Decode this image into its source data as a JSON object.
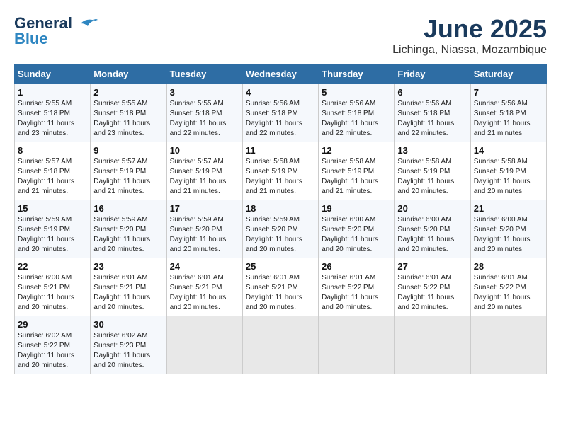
{
  "header": {
    "logo_general": "General",
    "logo_blue": "Blue",
    "title": "June 2025",
    "subtitle": "Lichinga, Niassa, Mozambique"
  },
  "calendar": {
    "days_of_week": [
      "Sunday",
      "Monday",
      "Tuesday",
      "Wednesday",
      "Thursday",
      "Friday",
      "Saturday"
    ],
    "weeks": [
      [
        {
          "day": "",
          "empty": true
        },
        {
          "day": "",
          "empty": true
        },
        {
          "day": "",
          "empty": true
        },
        {
          "day": "",
          "empty": true
        },
        {
          "day": "",
          "empty": true
        },
        {
          "day": "",
          "empty": true
        },
        {
          "day": "",
          "empty": true
        }
      ],
      [
        {
          "num": "1",
          "rise": "5:55 AM",
          "set": "5:18 PM",
          "daylight": "11 hours and 23 minutes."
        },
        {
          "num": "2",
          "rise": "5:55 AM",
          "set": "5:18 PM",
          "daylight": "11 hours and 23 minutes."
        },
        {
          "num": "3",
          "rise": "5:55 AM",
          "set": "5:18 PM",
          "daylight": "11 hours and 22 minutes."
        },
        {
          "num": "4",
          "rise": "5:56 AM",
          "set": "5:18 PM",
          "daylight": "11 hours and 22 minutes."
        },
        {
          "num": "5",
          "rise": "5:56 AM",
          "set": "5:18 PM",
          "daylight": "11 hours and 22 minutes."
        },
        {
          "num": "6",
          "rise": "5:56 AM",
          "set": "5:18 PM",
          "daylight": "11 hours and 22 minutes."
        },
        {
          "num": "7",
          "rise": "5:56 AM",
          "set": "5:18 PM",
          "daylight": "11 hours and 21 minutes."
        }
      ],
      [
        {
          "num": "8",
          "rise": "5:57 AM",
          "set": "5:18 PM",
          "daylight": "11 hours and 21 minutes."
        },
        {
          "num": "9",
          "rise": "5:57 AM",
          "set": "5:19 PM",
          "daylight": "11 hours and 21 minutes."
        },
        {
          "num": "10",
          "rise": "5:57 AM",
          "set": "5:19 PM",
          "daylight": "11 hours and 21 minutes."
        },
        {
          "num": "11",
          "rise": "5:58 AM",
          "set": "5:19 PM",
          "daylight": "11 hours and 21 minutes."
        },
        {
          "num": "12",
          "rise": "5:58 AM",
          "set": "5:19 PM",
          "daylight": "11 hours and 21 minutes."
        },
        {
          "num": "13",
          "rise": "5:58 AM",
          "set": "5:19 PM",
          "daylight": "11 hours and 20 minutes."
        },
        {
          "num": "14",
          "rise": "5:58 AM",
          "set": "5:19 PM",
          "daylight": "11 hours and 20 minutes."
        }
      ],
      [
        {
          "num": "15",
          "rise": "5:59 AM",
          "set": "5:19 PM",
          "daylight": "11 hours and 20 minutes."
        },
        {
          "num": "16",
          "rise": "5:59 AM",
          "set": "5:20 PM",
          "daylight": "11 hours and 20 minutes."
        },
        {
          "num": "17",
          "rise": "5:59 AM",
          "set": "5:20 PM",
          "daylight": "11 hours and 20 minutes."
        },
        {
          "num": "18",
          "rise": "5:59 AM",
          "set": "5:20 PM",
          "daylight": "11 hours and 20 minutes."
        },
        {
          "num": "19",
          "rise": "6:00 AM",
          "set": "5:20 PM",
          "daylight": "11 hours and 20 minutes."
        },
        {
          "num": "20",
          "rise": "6:00 AM",
          "set": "5:20 PM",
          "daylight": "11 hours and 20 minutes."
        },
        {
          "num": "21",
          "rise": "6:00 AM",
          "set": "5:20 PM",
          "daylight": "11 hours and 20 minutes."
        }
      ],
      [
        {
          "num": "22",
          "rise": "6:00 AM",
          "set": "5:21 PM",
          "daylight": "11 hours and 20 minutes."
        },
        {
          "num": "23",
          "rise": "6:01 AM",
          "set": "5:21 PM",
          "daylight": "11 hours and 20 minutes."
        },
        {
          "num": "24",
          "rise": "6:01 AM",
          "set": "5:21 PM",
          "daylight": "11 hours and 20 minutes."
        },
        {
          "num": "25",
          "rise": "6:01 AM",
          "set": "5:21 PM",
          "daylight": "11 hours and 20 minutes."
        },
        {
          "num": "26",
          "rise": "6:01 AM",
          "set": "5:22 PM",
          "daylight": "11 hours and 20 minutes."
        },
        {
          "num": "27",
          "rise": "6:01 AM",
          "set": "5:22 PM",
          "daylight": "11 hours and 20 minutes."
        },
        {
          "num": "28",
          "rise": "6:01 AM",
          "set": "5:22 PM",
          "daylight": "11 hours and 20 minutes."
        }
      ],
      [
        {
          "num": "29",
          "rise": "6:02 AM",
          "set": "5:22 PM",
          "daylight": "11 hours and 20 minutes."
        },
        {
          "num": "30",
          "rise": "6:02 AM",
          "set": "5:23 PM",
          "daylight": "11 hours and 20 minutes."
        },
        {
          "num": "",
          "empty": true
        },
        {
          "num": "",
          "empty": true
        },
        {
          "num": "",
          "empty": true
        },
        {
          "num": "",
          "empty": true
        },
        {
          "num": "",
          "empty": true
        }
      ]
    ],
    "labels": {
      "sunrise": "Sunrise:",
      "sunset": "Sunset:",
      "daylight": "Daylight:"
    }
  }
}
